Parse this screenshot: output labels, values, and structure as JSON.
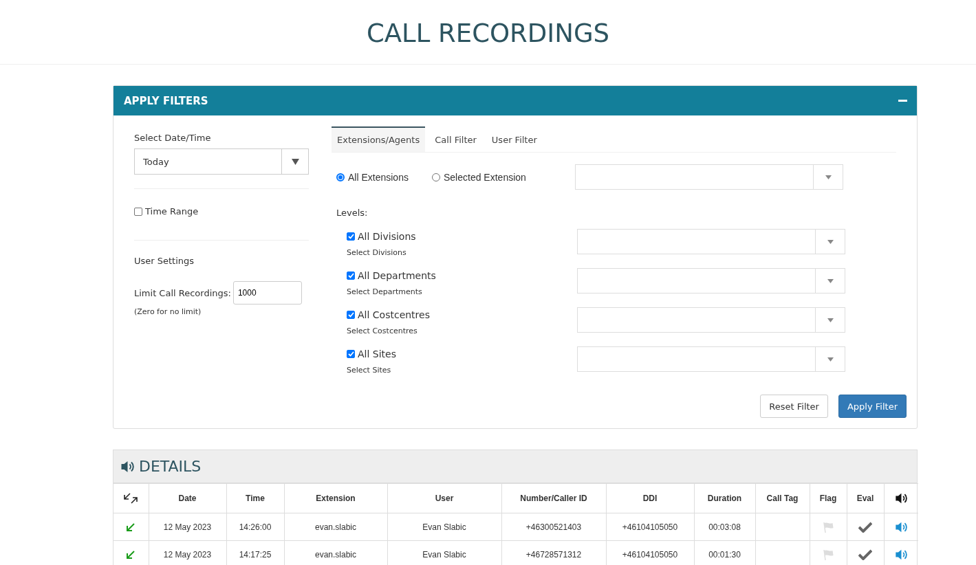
{
  "page": {
    "title": "CALL RECORDINGS"
  },
  "filters": {
    "title": "APPLY FILTERS",
    "date_label": "Select Date/Time",
    "date_value": "Today",
    "time_range": {
      "label": "Time Range",
      "checked": false
    },
    "user_settings_title": "User Settings",
    "limit_label": "Limit Call Recordings:",
    "limit_value": "1000",
    "limit_hint": "(Zero for no limit)",
    "tabs": [
      {
        "label": "Extensions/Agents",
        "selected": true
      },
      {
        "label": "Call Filter",
        "selected": false
      },
      {
        "label": "User Filter",
        "selected": false
      }
    ],
    "extension_options": [
      {
        "label": "All Extensions",
        "selected": true
      },
      {
        "label": "Selected Extension",
        "selected": false
      }
    ],
    "levels_label": "Levels:",
    "levels": [
      {
        "label": "All Divisions",
        "checked": true,
        "hint": "Select Divisions"
      },
      {
        "label": "All Departments",
        "checked": true,
        "hint": "Select Departments"
      },
      {
        "label": "All Costcentres",
        "checked": true,
        "hint": "Select Costcentres"
      },
      {
        "label": "All Sites",
        "checked": true,
        "hint": "Select Sites"
      }
    ],
    "buttons": [
      {
        "label": "Reset Filter",
        "kind": "default"
      },
      {
        "label": "Apply Filter",
        "kind": "primary"
      }
    ]
  },
  "details": {
    "title": "DETAILS",
    "columns": [
      "Date",
      "Time",
      "Extension",
      "User",
      "Number/Caller ID",
      "DDI",
      "Duration",
      "Call Tag",
      "Flag",
      "Eval"
    ],
    "rows": [
      {
        "kind": "incoming",
        "date": "12 May 2023",
        "time": "14:26:00",
        "extension": "evan.slabic",
        "user": "Evan Slabic",
        "number": "+46300521403",
        "ddi": "+46104105050",
        "duration": "00:03:08",
        "flagged": false
      },
      {
        "kind": "incoming",
        "date": "12 May 2023",
        "time": "14:17:25",
        "extension": "evan.slabic",
        "user": "Evan Slabic",
        "number": "+46728571312",
        "ddi": "+46104105050",
        "duration": "00:01:30",
        "flagged": false
      }
    ]
  }
}
